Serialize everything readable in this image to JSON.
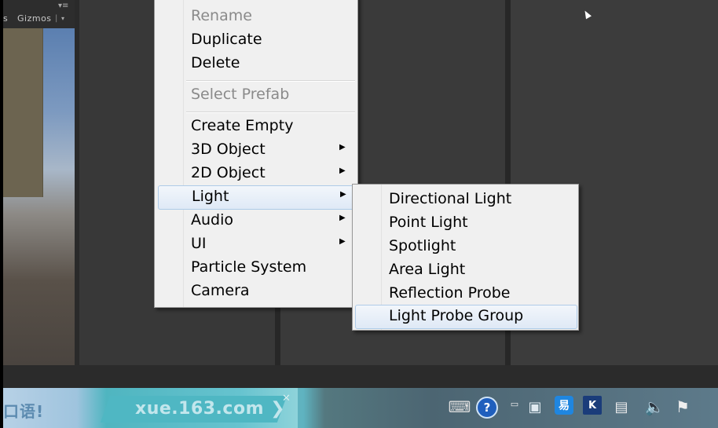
{
  "scene_toolbar": {
    "left_fragment": "s",
    "gizmos_label": "Gizmos"
  },
  "context_menu": {
    "items": [
      {
        "label": "Rename",
        "disabled": true
      },
      {
        "label": "Duplicate"
      },
      {
        "label": "Delete"
      },
      {
        "label": "Select Prefab",
        "disabled": true
      },
      {
        "label": "Create Empty"
      },
      {
        "label": "3D Object",
        "submenu": true
      },
      {
        "label": "2D Object",
        "submenu": true
      },
      {
        "label": "Light",
        "submenu": true,
        "highlighted": true
      },
      {
        "label": "Audio",
        "submenu": true
      },
      {
        "label": "UI",
        "submenu": true
      },
      {
        "label": "Particle System"
      },
      {
        "label": "Camera"
      }
    ]
  },
  "light_submenu": {
    "items": [
      {
        "label": "Directional Light"
      },
      {
        "label": "Point Light"
      },
      {
        "label": "Spotlight"
      },
      {
        "label": "Area Light"
      },
      {
        "label": "Reflection Probe"
      },
      {
        "label": "Light Probe Group",
        "highlighted": true
      }
    ]
  },
  "taskbar": {
    "ad_left_text": "口语!",
    "ad_url_text": "xue.163.com",
    "ad_arrow": "❯",
    "tray_icons": [
      "keyboard-icon",
      "help-icon",
      "screen-icon",
      "app-icon",
      "km-icon",
      "network-icon",
      "volume-icon",
      "action-center-flag-icon"
    ]
  },
  "colors": {
    "menu_bg": "#f0f0f0",
    "menu_highlight": "#dfe9f6",
    "disabled_text": "#8a8a8a",
    "editor_bg": "#3a3a3a"
  }
}
